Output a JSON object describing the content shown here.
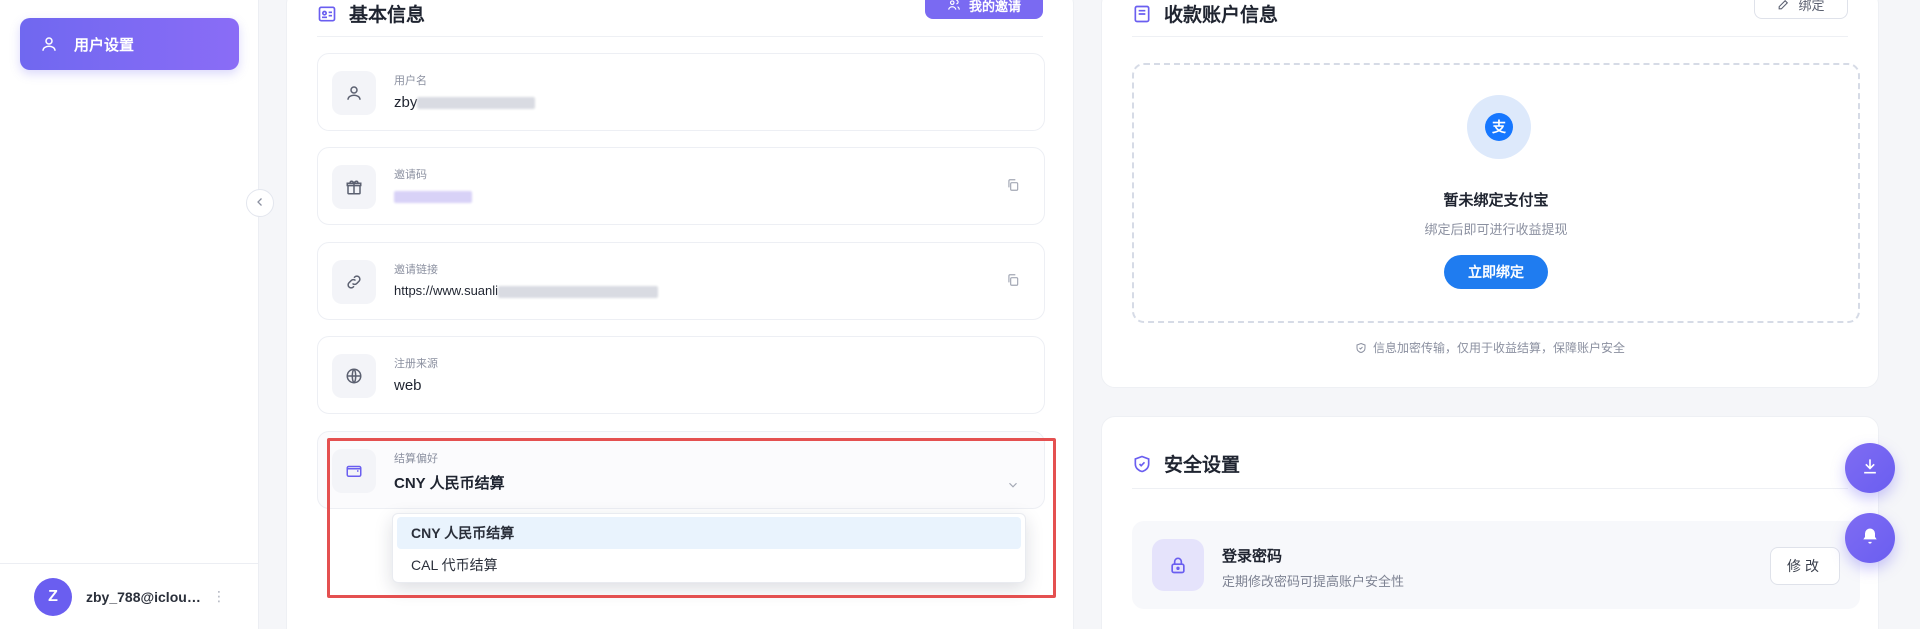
{
  "colors": {
    "accent": "#6a5ef0",
    "primary_blue": "#1f7cf0",
    "highlight_red": "#e45050"
  },
  "sidebar": {
    "active_item": {
      "label": "用户设置",
      "icon": "user-icon"
    },
    "footer": {
      "avatar_letter": "Z",
      "user_name": "zby_788@icloud...."
    },
    "collapse_icon": "chevron-left-icon"
  },
  "basic_info": {
    "title": "基本信息",
    "invite_button": "我的邀请",
    "fields": [
      {
        "label": "用户名",
        "value": "zby",
        "icon": "user-icon"
      },
      {
        "label": "邀请码",
        "value": "",
        "icon": "gift-icon"
      },
      {
        "label": "邀请链接",
        "value": "https://www.suanli",
        "icon": "link-icon"
      },
      {
        "label": "注册来源",
        "value": "web",
        "icon": "globe-icon"
      }
    ],
    "settlement": {
      "label": "结算偏好",
      "value": "CNY 人民币结算",
      "icon": "wallet-icon",
      "options": [
        "CNY 人民币结算",
        "CAL 代币结算"
      ]
    }
  },
  "payment_account": {
    "title": "收款账户信息",
    "bind_button": "绑定",
    "empty_title": "暂未绑定支付宝",
    "empty_subtitle": "绑定后即可进行收益提现",
    "bind_now_button": "立即绑定",
    "alipay_symbol": "支",
    "secure_note": "信息加密传输，仅用于收益结算，保障账户安全"
  },
  "security": {
    "title": "安全设置",
    "login_password": {
      "title": "登录密码",
      "subtitle": "定期修改密码可提高账户安全性",
      "button": "修改"
    }
  }
}
